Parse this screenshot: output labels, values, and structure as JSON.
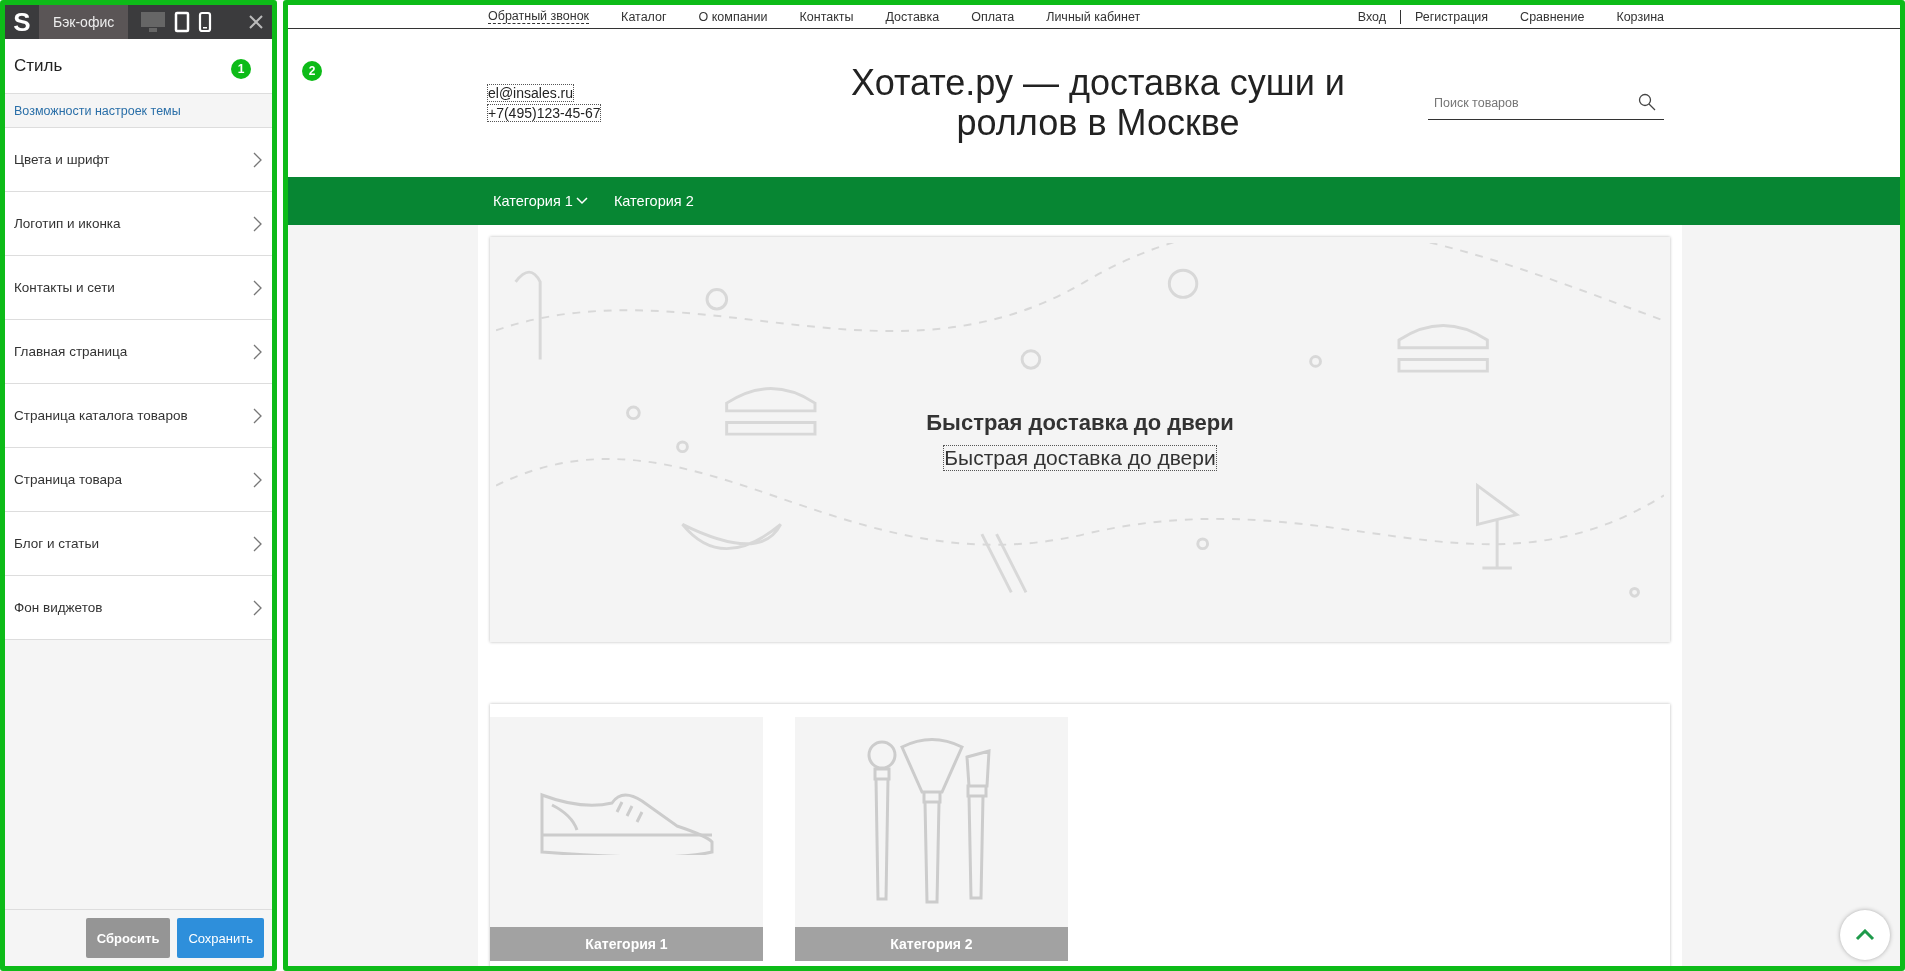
{
  "annotations": [
    {
      "label": "1"
    },
    {
      "label": "2"
    }
  ],
  "editor": {
    "logo": "S",
    "tab": "Бэк-офис",
    "devices": [
      {
        "kind": "desktop",
        "selected": true
      },
      {
        "kind": "tablet",
        "selected": false
      },
      {
        "kind": "phone",
        "selected": false
      }
    ],
    "section_title": "Стиль",
    "help_link": "Возможности настроек темы",
    "items": [
      "Цвета и шрифт",
      "Логотип и иконка",
      "Контакты и сети",
      "Главная страница",
      "Страница каталога товаров",
      "Страница товара",
      "Блог и статьи",
      "Фон виджетов"
    ],
    "reset_button": "Сбросить",
    "save_button": "Сохранить"
  },
  "site": {
    "top_links": [
      {
        "label": "Обратный звонок",
        "dashed": true
      },
      {
        "label": "Каталог",
        "dashed": false
      },
      {
        "label": "О компании",
        "dashed": false
      },
      {
        "label": "Контакты",
        "dashed": false
      },
      {
        "label": "Доставка",
        "dashed": false
      },
      {
        "label": "Оплата",
        "dashed": false
      },
      {
        "label": "Личный кабинет",
        "dashed": false
      }
    ],
    "account_links": [
      "Вход",
      "Регистрация",
      "Сравнение",
      "Корзина"
    ],
    "email": "el@insales.ru",
    "phone": "+7(495)123-45-67",
    "title": "Хотате.ру — доставка суши и роллов в Москве",
    "search": {
      "placeholder": "Поиск товаров"
    },
    "menu": [
      {
        "label": "Категория 1",
        "has_dropdown": true
      },
      {
        "label": "Категория 2",
        "has_dropdown": false
      }
    ],
    "banner": {
      "title": "Быстрая доставка до двери",
      "subtitle": "Быстрая доставка до двери"
    },
    "categories": [
      {
        "label": "Категория 1",
        "kind": "shoe"
      },
      {
        "label": "Категория 2",
        "kind": "brushes"
      }
    ]
  }
}
